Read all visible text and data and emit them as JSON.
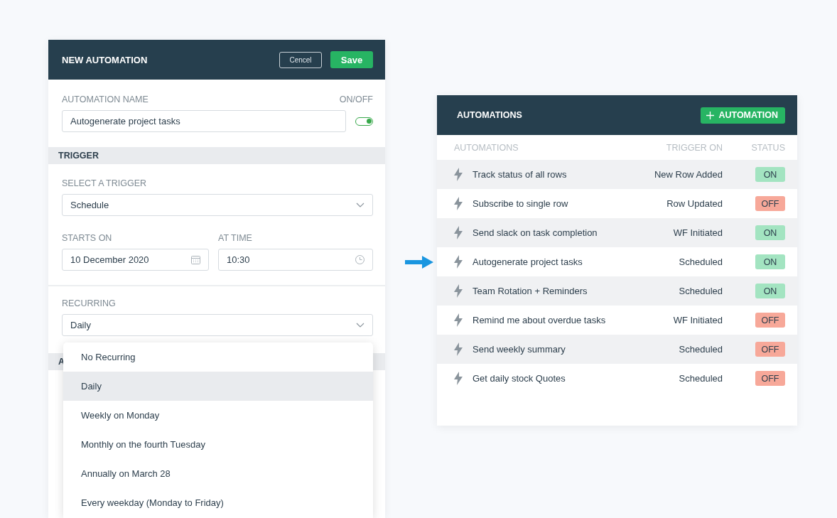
{
  "editor": {
    "title": "NEW AUTOMATION",
    "cancel_button": "Cencel",
    "save_button": "Save",
    "name_label": "AUTOMATION NAME",
    "toggle_label": "ON/OFF",
    "name_value": "Autogenerate project tasks",
    "enabled": true,
    "trigger_header": "TRIGGER",
    "trigger_label": "SELECT A TRIGGER",
    "trigger_value": "Schedule",
    "starts_label": "STARTS ON",
    "starts_value": "10 December 2020",
    "time_label": "AT TIME",
    "time_value": "10:30",
    "recurring_label": "RECURRING",
    "recurring_value": "Daily",
    "next_header": "A",
    "recurring_options": [
      {
        "label": "No Recurring",
        "selected": false
      },
      {
        "label": "Daily",
        "selected": true
      },
      {
        "label": "Weekly on Monday",
        "selected": false
      },
      {
        "label": "Monthly on the fourth Tuesday",
        "selected": false
      },
      {
        "label": "Annually on March 28",
        "selected": false
      },
      {
        "label": "Every weekday (Monday to Friday)",
        "selected": false
      }
    ]
  },
  "list": {
    "title": "AUTOMATIONS",
    "add_button": "AUTOMATION",
    "columns": [
      "AUTOMATIONS",
      "TRIGGER ON",
      "STATUS"
    ],
    "rows": [
      {
        "name": "Track status of all rows",
        "trigger": "New Row Added",
        "status": "ON",
        "on": true
      },
      {
        "name": "Subscribe to single row",
        "trigger": "Row Updated",
        "status": "OFF",
        "on": false
      },
      {
        "name": "Send slack on task completion",
        "trigger": "WF Initiated",
        "status": "ON",
        "on": true
      },
      {
        "name": "Autogenerate project tasks",
        "trigger": "Scheduled",
        "status": "ON",
        "on": true
      },
      {
        "name": "Team Rotation + Reminders",
        "trigger": "Scheduled",
        "status": "ON",
        "on": true
      },
      {
        "name": "Remind me about overdue tasks",
        "trigger": "WF Initiated",
        "status": "OFF",
        "on": false
      },
      {
        "name": "Send weekly summary",
        "trigger": "Scheduled",
        "status": "OFF",
        "on": false
      },
      {
        "name": "Get daily stock Quotes",
        "trigger": "Scheduled",
        "status": "OFF",
        "on": false
      }
    ]
  }
}
